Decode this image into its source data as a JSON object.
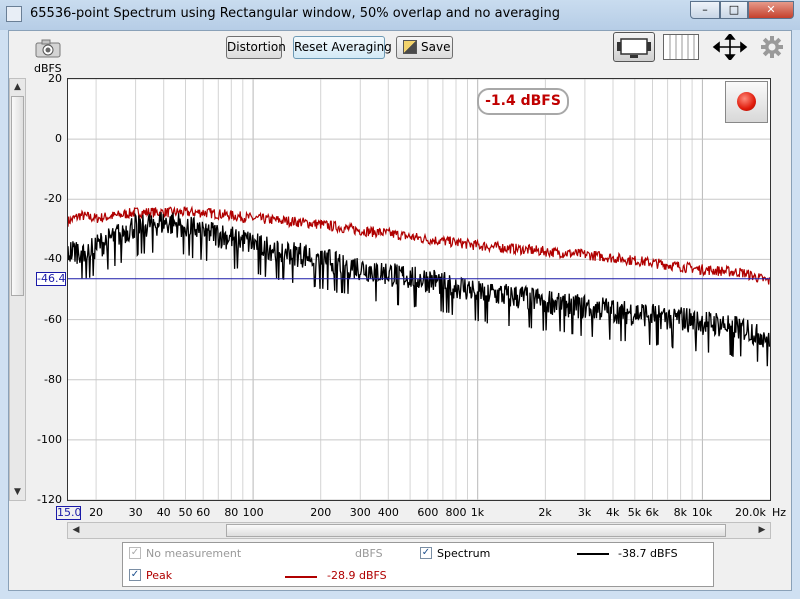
{
  "window": {
    "title": "65536-point Spectrum using Rectangular window, 50% overlap and no averaging",
    "min_glyph": "–",
    "max_glyph": "□",
    "close_glyph": "✕"
  },
  "toolbar": {
    "distortion_label": "Distortion",
    "reset_label": "Reset Averaging",
    "save_label": "Save",
    "icons": [
      "camera-icon",
      "save-icon",
      "overview-icon",
      "grid-icon",
      "move-icon",
      "gear-icon"
    ]
  },
  "chart_data": {
    "type": "line",
    "xscale": "log",
    "xlim": [
      15,
      20000
    ],
    "ylim": [
      -120,
      20
    ],
    "ylabel": "dBFS",
    "xunit": "Hz",
    "y_ticks": [
      "20",
      "0",
      "-20",
      "-40",
      "-60",
      "-80",
      "-100",
      "-120"
    ],
    "x_tick_labels": [
      {
        "f": 20,
        "t": "20"
      },
      {
        "f": 30,
        "t": "30"
      },
      {
        "f": 40,
        "t": "40"
      },
      {
        "f": 50,
        "t": "50"
      },
      {
        "f": 60,
        "t": "60"
      },
      {
        "f": 80,
        "t": "80"
      },
      {
        "f": 100,
        "t": "100"
      },
      {
        "f": 200,
        "t": "200"
      },
      {
        "f": 300,
        "t": "300"
      },
      {
        "f": 400,
        "t": "400"
      },
      {
        "f": 600,
        "t": "600"
      },
      {
        "f": 800,
        "t": "800"
      },
      {
        "f": 1000,
        "t": "1k"
      },
      {
        "f": 2000,
        "t": "2k"
      },
      {
        "f": 3000,
        "t": "3k"
      },
      {
        "f": 4000,
        "t": "4k"
      },
      {
        "f": 5000,
        "t": "5k"
      },
      {
        "f": 6000,
        "t": "6k"
      },
      {
        "f": 8000,
        "t": "8k"
      },
      {
        "f": 10000,
        "t": "10k"
      },
      {
        "f": 20000,
        "t": "20.0k"
      }
    ],
    "x_start_label": "15.0",
    "cursor_level": -46.4,
    "cursor_label": "-46.4",
    "peak_readout": "-1.4 dBFS",
    "series": [
      {
        "name": "Peak",
        "color": "#b00000",
        "points": [
          [
            15,
            -27
          ],
          [
            17,
            -25
          ],
          [
            20,
            -26
          ],
          [
            25,
            -25
          ],
          [
            30,
            -24
          ],
          [
            40,
            -24
          ],
          [
            50,
            -24
          ],
          [
            60,
            -24
          ],
          [
            80,
            -25
          ],
          [
            100,
            -26
          ],
          [
            150,
            -27
          ],
          [
            200,
            -28
          ],
          [
            300,
            -30
          ],
          [
            400,
            -31
          ],
          [
            600,
            -33
          ],
          [
            800,
            -34
          ],
          [
            1000,
            -35
          ],
          [
            2000,
            -37
          ],
          [
            3000,
            -38
          ],
          [
            5000,
            -40
          ],
          [
            8000,
            -42
          ],
          [
            10000,
            -43
          ],
          [
            15000,
            -44
          ],
          [
            20000,
            -47
          ]
        ]
      },
      {
        "name": "Spectrum",
        "color": "#000000",
        "points": [
          [
            15,
            -39
          ],
          [
            20,
            -37
          ],
          [
            25,
            -33
          ],
          [
            30,
            -30
          ],
          [
            40,
            -29
          ],
          [
            50,
            -30
          ],
          [
            60,
            -32
          ],
          [
            80,
            -34
          ],
          [
            100,
            -36
          ],
          [
            150,
            -39
          ],
          [
            200,
            -41
          ],
          [
            300,
            -44
          ],
          [
            400,
            -46
          ],
          [
            600,
            -48
          ],
          [
            800,
            -50
          ],
          [
            1000,
            -52
          ],
          [
            2000,
            -55
          ],
          [
            3000,
            -57
          ],
          [
            5000,
            -59
          ],
          [
            8000,
            -61
          ],
          [
            10000,
            -62
          ],
          [
            15000,
            -64
          ],
          [
            20000,
            -67
          ]
        ]
      }
    ]
  },
  "legend": {
    "no_measurement_label": "No measurement",
    "no_measurement_unit": "dBFS",
    "spectrum_label": "Spectrum",
    "spectrum_value": "-38.7 dBFS",
    "peak_label": "Peak",
    "peak_value": "-28.9 dBFS",
    "peak_color": "#b00000",
    "check_glyph": "✓"
  },
  "scrollbars": {
    "up_glyph": "▲",
    "down_glyph": "▼",
    "left_glyph": "◀",
    "right_glyph": "▶"
  }
}
